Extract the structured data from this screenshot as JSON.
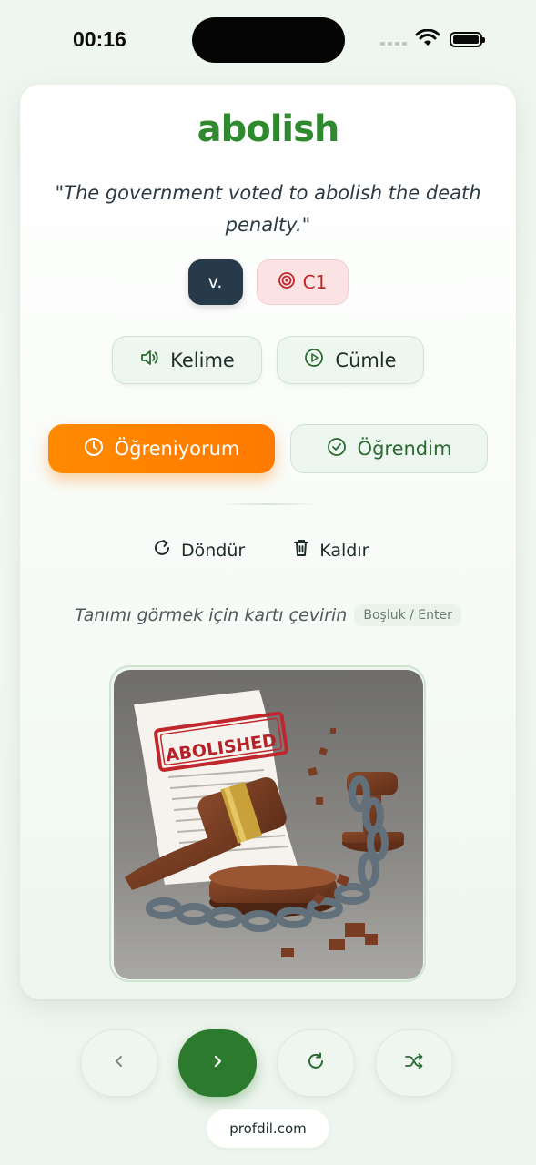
{
  "status_bar": {
    "time": "00:16"
  },
  "card": {
    "word": "abolish",
    "example": "\"The government voted to abolish the death penalty.\"",
    "part_of_speech": "v.",
    "level": "C1",
    "audio": {
      "word_label": "Kelime",
      "sentence_label": "Cümle"
    },
    "status": {
      "learning_label": "Öğreniyorum",
      "learned_label": "Öğrendim"
    },
    "actions": {
      "flip_label": "Döndür",
      "remove_label": "Kaldır"
    },
    "hint": "Tanımı görmek için kartı çevirin",
    "shortcut": "Boşluk / Enter",
    "image_stamp": "ABOLISHED"
  },
  "nav": {
    "icons": [
      "chevron-left-icon",
      "chevron-right-icon",
      "refresh-icon",
      "shuffle-icon"
    ]
  },
  "footer": {
    "site": "profdil.com"
  },
  "colors": {
    "brand_green": "#2f8a2f",
    "accent_orange": "#ff8a00",
    "pos_tag": "#263a4a",
    "level_tag_bg": "#fbe3e3",
    "level_tag_text": "#c0272d"
  }
}
